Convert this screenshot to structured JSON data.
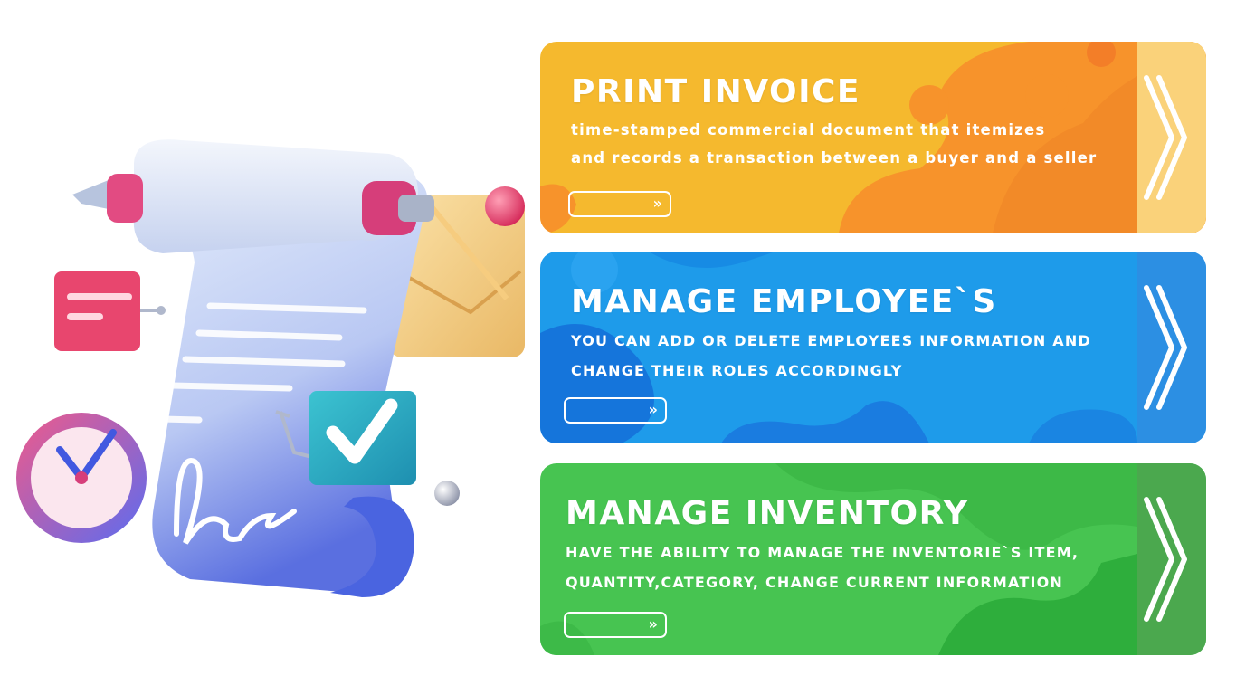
{
  "cards": [
    {
      "id": "print-invoice",
      "title": "PRINT INVOICE",
      "desc_line1": "time-stamped commercial document that itemizes",
      "desc_line2": "and records a transaction between a buyer and a seller",
      "button_icon": "»",
      "chevron_icon": "double-chevron-right-icon",
      "colors": {
        "base": "#F5B92E",
        "accent": "#F7932B",
        "panel": "#FAD27A"
      }
    },
    {
      "id": "manage-employees",
      "title": "MANAGE EMPLOYEE`S",
      "desc_line1": "YOU CAN ADD OR DELETE EMPLOYEES INFORMATION AND",
      "desc_line2": "CHANGE THEIR ROLES ACCORDINGLY",
      "button_icon": "»",
      "chevron_icon": "double-chevron-right-icon",
      "colors": {
        "base": "#1E9BEA",
        "accent": "#1575DB",
        "panel": "#2C8FE3"
      }
    },
    {
      "id": "manage-inventory",
      "title": "MANAGE INVENTORY",
      "desc_line1": "HAVE THE ABILITY TO MANAGE THE INVENTORIE`S ITEM,",
      "desc_line2": "QUANTITY,CATEGORY, CHANGE CURRENT INFORMATION",
      "button_icon": "»",
      "chevron_icon": "double-chevron-right-icon",
      "colors": {
        "base": "#47C451",
        "accent": "#2EAE3C",
        "panel": "#4BA84E"
      }
    }
  ]
}
